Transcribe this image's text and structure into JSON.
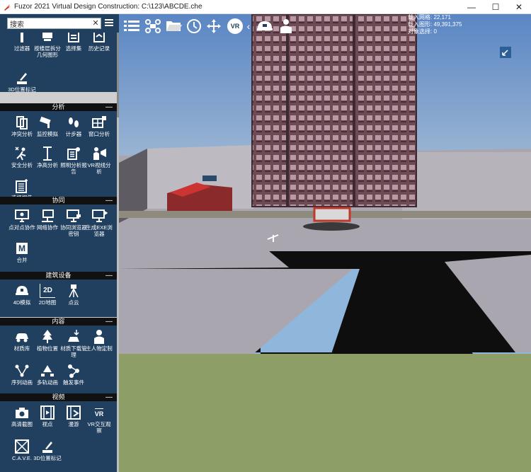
{
  "window": {
    "title": "Fuzor 2021 Virtual Design Construction: C:\\123\\ABCDE.che",
    "min": "—",
    "max": "☐",
    "close": "✕"
  },
  "search": {
    "value": "搜索",
    "clear": "✕"
  },
  "sections": {
    "top": {
      "tools": [
        {
          "label": "过滤器",
          "icon": "filter-icon"
        },
        {
          "label": "按楼层拆分几何图形",
          "icon": "split-geometry-icon"
        },
        {
          "label": "选择集",
          "icon": "selection-set-icon"
        },
        {
          "label": "历史记录",
          "icon": "history-icon"
        },
        {
          "label": "3D位置标记",
          "icon": "3d-marker-icon"
        }
      ]
    },
    "analysis": {
      "title": "分析",
      "collapse": "—",
      "tools": [
        {
          "label": "冲突分析",
          "icon": "clash-icon"
        },
        {
          "label": "监控模拟",
          "icon": "camera-monitor-icon"
        },
        {
          "label": "计步器",
          "icon": "footsteps-icon"
        },
        {
          "label": "窗口分析",
          "icon": "window-analysis-icon"
        },
        {
          "label": "安全分析",
          "icon": "safety-icon"
        },
        {
          "label": "净高分析",
          "icon": "clearance-icon"
        },
        {
          "label": "照明分析报告",
          "icon": "lighting-icon"
        },
        {
          "label": "VR视线分析",
          "icon": "vr-sight-icon"
        },
        {
          "label": "选择报告",
          "icon": "select-report-icon"
        }
      ]
    },
    "collab": {
      "title": "协同",
      "collapse": "—",
      "tools": [
        {
          "label": "点对点协作",
          "icon": "p2p-icon"
        },
        {
          "label": "网络协作",
          "icon": "network-icon"
        },
        {
          "label": "协同浏览器密钥",
          "icon": "browser-key-icon"
        },
        {
          "label": "生成EXE浏览器",
          "icon": "exe-icon"
        },
        {
          "label": "合并",
          "icon": "merge-icon",
          "glyph": "M"
        }
      ]
    },
    "building": {
      "title": "建筑设备",
      "collapse": "—",
      "tools": [
        {
          "label": "4D模拟",
          "icon": "4d-helmet-icon"
        },
        {
          "label": "2D地图",
          "icon": "2d-map-icon",
          "glyph": "2D"
        },
        {
          "label": "点云",
          "icon": "point-cloud-icon"
        }
      ]
    },
    "content": {
      "title": "内容",
      "collapse": "—",
      "tools": [
        {
          "label": "材质库",
          "icon": "car-icon"
        },
        {
          "label": "植物位置",
          "icon": "tree-icon"
        },
        {
          "label": "材质下载管理",
          "icon": "download-icon"
        },
        {
          "label": "主人物定制",
          "icon": "person-icon"
        },
        {
          "label": "序列动画",
          "icon": "sequence-icon"
        },
        {
          "label": "多轨动画",
          "icon": "multitrack-icon"
        },
        {
          "label": "触发事件",
          "icon": "trigger-icon"
        }
      ]
    },
    "video": {
      "title": "视频",
      "collapse": "—",
      "tools": [
        {
          "label": "高清截图",
          "icon": "camera-icon"
        },
        {
          "label": "视点",
          "icon": "film-icon"
        },
        {
          "label": "漫游",
          "icon": "walkthrough-icon"
        },
        {
          "label": "VR交互观察",
          "icon": "vr-interact-icon",
          "glyph": "VR"
        },
        {
          "label": "C.A.V.E.",
          "icon": "cave-icon"
        },
        {
          "label": "3D位置标记",
          "icon": "3d-marker-icon"
        }
      ]
    }
  },
  "toolbar": {
    "items": [
      {
        "name": "list-icon"
      },
      {
        "name": "drone-icon"
      },
      {
        "name": "folder-icon"
      },
      {
        "name": "clock-icon"
      },
      {
        "name": "move-icon"
      },
      {
        "name": "vr-icon",
        "glyph": "VR"
      },
      {
        "name": "collapse-chevron-icon",
        "glyph": "‹"
      },
      {
        "name": "helmet-icon"
      },
      {
        "name": "user-icon"
      }
    ]
  },
  "stats": {
    "mesh": "载入网格: 22,171",
    "polygons": "载入图形: 49,391,375",
    "selected": "对象选择:   0"
  },
  "colors": {
    "sidebar_bg": "#21405f",
    "section_header": "#111111",
    "sky_top": "#5a86c4",
    "sky_bottom": "#a6bdd6",
    "ground": "#8d9e66",
    "road": "#0e0e0e",
    "sidewalk": "#a9a6b0",
    "building": "#6e4a55"
  }
}
